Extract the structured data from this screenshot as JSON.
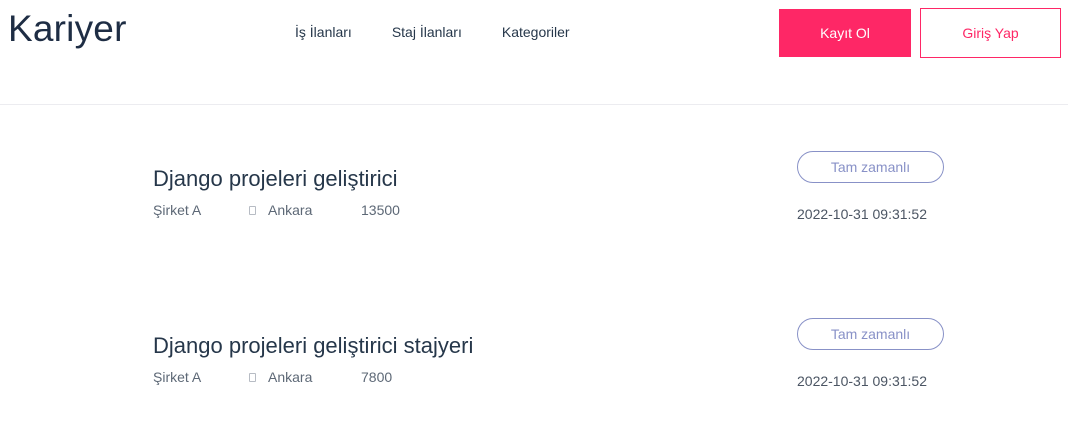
{
  "header": {
    "logo": "Kariyer",
    "nav": [
      "İş İlanları",
      "Staj İlanları",
      "Kategoriler"
    ],
    "register_label": "Kayıt Ol",
    "login_label": "Giriş Yap"
  },
  "jobs": [
    {
      "title": "Django projeleri geliştirici",
      "company": "Şirket A",
      "location": "Ankara",
      "salary": "13500",
      "type": "Tam zamanlı",
      "date": "2022-10-31 09:31:52"
    },
    {
      "title": "Django projeleri geliştirici stajyeri",
      "company": "Şirket A",
      "location": "Ankara",
      "salary": "7800",
      "type": "Tam zamanlı",
      "date": "2022-10-31 09:31:52"
    }
  ],
  "colors": {
    "accent": "#fe2766",
    "badge": "#8891c7",
    "text": "#26374a"
  }
}
